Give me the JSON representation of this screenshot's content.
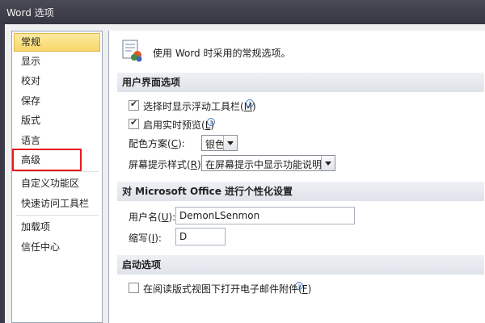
{
  "window": {
    "title": "Word 选项"
  },
  "sidebar": {
    "items": [
      {
        "label": "常规"
      },
      {
        "label": "显示"
      },
      {
        "label": "校对"
      },
      {
        "label": "保存"
      },
      {
        "label": "版式"
      },
      {
        "label": "语言"
      },
      {
        "label": "高级"
      },
      {
        "label": "自定义功能区"
      },
      {
        "label": "快速访问工具栏"
      },
      {
        "label": "加载项"
      },
      {
        "label": "信任中心"
      }
    ]
  },
  "main": {
    "header": "使用 Word 时采用的常规选项。",
    "ui_section": {
      "title": "用户界面选项",
      "mini_toolbar": {
        "label_pre": "选择时显示浮动工具栏(",
        "key": "M",
        "label_post": ")",
        "checked": true
      },
      "live_preview": {
        "label_pre": "启用实时预览(",
        "key": "L",
        "label_post": ")",
        "checked": true
      },
      "color_scheme": {
        "label_pre": "配色方案(",
        "key": "C",
        "label_post": "):",
        "value": "银色"
      },
      "screentip": {
        "label_pre": "屏幕提示样式(",
        "key": "R",
        "label_post": "):",
        "value": "在屏幕提示中显示功能说明"
      }
    },
    "personalize_section": {
      "title": "对 Microsoft Office 进行个性化设置",
      "username": {
        "label_pre": "用户名(",
        "key": "U",
        "label_post": "):",
        "value": "DemonLSenmon"
      },
      "initials": {
        "label_pre": "缩写(",
        "key": "I",
        "label_post": "):",
        "value": "D"
      }
    },
    "startup_section": {
      "title": "启动选项",
      "open_reading": {
        "label_pre": "在阅读版式视图下打开电子邮件附件(",
        "key": "F",
        "label_post": ")",
        "checked": false
      }
    }
  },
  "colors": {
    "highlight_box": "#e8191e",
    "selected_item": "#f8d66a"
  }
}
